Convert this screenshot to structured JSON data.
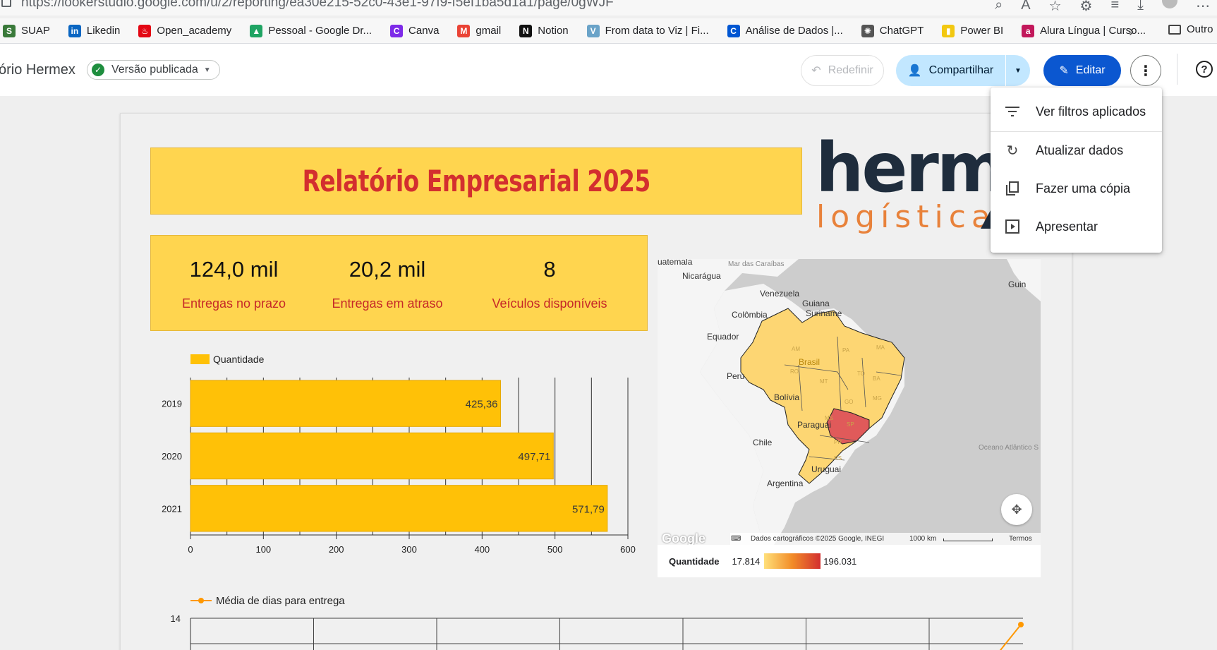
{
  "browser": {
    "url": "https://lookerstudio.google.com/u/2/reporting/ea30e215-52c0-43e1-97f9-f5ef1ba5d1a1/page/0gWJF",
    "bookmarks": [
      {
        "label": "SUAP",
        "icon": "suap-icon",
        "color": "#3a7a3a"
      },
      {
        "label": "Likedin",
        "icon": "linkedin-icon",
        "color": "#0a66c2"
      },
      {
        "label": "Open_academy",
        "icon": "santander-icon",
        "color": "#e30613"
      },
      {
        "label": "Pessoal - Google Dr...",
        "icon": "google-drive-icon",
        "color": "#1fa463"
      },
      {
        "label": "Canva",
        "icon": "canva-icon",
        "color": "#7d2ae8"
      },
      {
        "label": "gmail",
        "icon": "gmail-icon",
        "color": "#ea4335"
      },
      {
        "label": "Notion",
        "icon": "notion-icon",
        "color": "#111111"
      },
      {
        "label": "From data to Viz | Fi...",
        "icon": "data-to-viz-icon",
        "color": "#6aa3c8"
      },
      {
        "label": "Análise de Dados |...",
        "icon": "coursera-icon",
        "color": "#0056d2"
      },
      {
        "label": "ChatGPT",
        "icon": "chatgpt-icon",
        "color": "#555555"
      },
      {
        "label": "Power BI",
        "icon": "powerbi-icon",
        "color": "#f2c811"
      },
      {
        "label": "Alura Língua | Curso...",
        "icon": "alura-icon",
        "color": "#c2185b"
      }
    ],
    "others_label": "Outro"
  },
  "header": {
    "report_title": "ório Hermex",
    "version_label": "Versão publicada",
    "reset_label": "Redefinir",
    "share_label": "Compartilhar",
    "edit_label": "Editar"
  },
  "menu": {
    "items": [
      {
        "label": "Ver filtros aplicados",
        "icon": "filter-list-icon"
      },
      {
        "label": "Atualizar dados",
        "icon": "refresh-icon"
      },
      {
        "label": "Fazer uma cópia",
        "icon": "copy-icon"
      },
      {
        "label": "Apresentar",
        "icon": "present-icon"
      }
    ]
  },
  "report": {
    "title": "Relatório Empresarial 2025",
    "logo": {
      "top": "herme",
      "bottom": "logística"
    },
    "kpis": [
      {
        "value": "124,0 mil",
        "label": "Entregas no prazo"
      },
      {
        "value": "20,2 mil",
        "label": "Entregas em atraso"
      },
      {
        "value": "8",
        "label": "Veículos disponíveis"
      }
    ],
    "map": {
      "legend_label": "Quantidade",
      "min_label": "17.814",
      "max_label": "196.031",
      "attribution": "Dados cartográficos ©2025 Google, INEGI",
      "scale": "1000 km",
      "terms": "Termos",
      "google_label": "Google",
      "labels": [
        "uatemala",
        "Mar das Caraíbas",
        "Nicarágua",
        "Venezuela",
        "Guiana",
        "Suriname",
        "Colômbia",
        "Equador",
        "Peru",
        "Brasil",
        "Bolívia",
        "Paraguai",
        "Chile",
        "Uruguai",
        "Argentina",
        "Oceano Atlântico S",
        "Guin"
      ],
      "state_labels": [
        "AM",
        "PA",
        "MT",
        "MS",
        "RO",
        "TO",
        "BA",
        "MG",
        "SP",
        "PR",
        "RS",
        "MA",
        "GO"
      ]
    }
  },
  "chart_data": [
    {
      "type": "bar",
      "orientation": "horizontal",
      "categories": [
        "2019",
        "2020",
        "2021"
      ],
      "series": [
        {
          "name": "Quantidade",
          "values": [
            425.36,
            497.71,
            571.79
          ]
        }
      ],
      "data_labels": [
        "425,36",
        "497,71",
        "571,79"
      ],
      "xlim": [
        0,
        600
      ],
      "xticks": [
        "0",
        "100",
        "200",
        "300",
        "400",
        "500",
        "600"
      ],
      "colors": {
        "bar": "#ffc107",
        "border": "#e6a800"
      }
    },
    {
      "type": "line",
      "series": [
        {
          "name": "Média de dias para entrega"
        }
      ],
      "yticks": [
        "14"
      ],
      "colors": {
        "line": "#ff9800"
      }
    }
  ]
}
